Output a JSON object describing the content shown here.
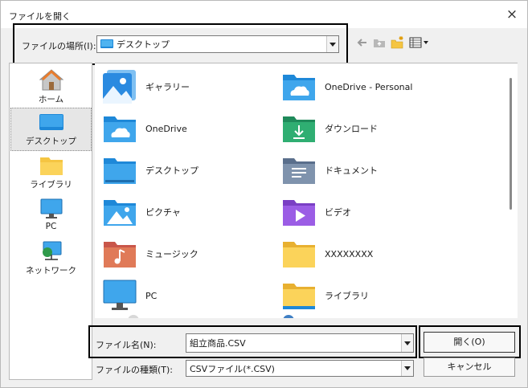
{
  "window": {
    "title": "ファイルを開く",
    "close_glyph": "×"
  },
  "location": {
    "label": "ファイルの場所(I):",
    "value": "デスクトップ"
  },
  "sidebar": {
    "items": [
      {
        "label": "ホーム",
        "icon": "home-icon"
      },
      {
        "label": "デスクトップ",
        "icon": "desktop-icon",
        "selected": true
      },
      {
        "label": "ライブラリ",
        "icon": "library-icon"
      },
      {
        "label": "PC",
        "icon": "pc-icon"
      },
      {
        "label": "ネットワーク",
        "icon": "network-icon"
      }
    ]
  },
  "files": {
    "left": [
      "ギャラリー",
      "OneDrive",
      "デスクトップ",
      "ピクチャ",
      "ミュージック",
      "PC"
    ],
    "right": [
      "OneDrive - Personal",
      "ダウンロード",
      "ドキュメント",
      "ビデオ",
      "XXXXXXXX",
      "ライブラリ"
    ]
  },
  "filename": {
    "label": "ファイル名(N):",
    "value": "組立商品.CSV"
  },
  "filetype": {
    "label": "ファイルの種類(T):",
    "value": "CSVファイル(*.CSV)"
  },
  "buttons": {
    "open": "開く(O)",
    "cancel": "キャンセル"
  },
  "colors": {
    "folder_blue": "#1e88d8",
    "folder_yellow": "#f5c542",
    "highlight": "#000000"
  }
}
